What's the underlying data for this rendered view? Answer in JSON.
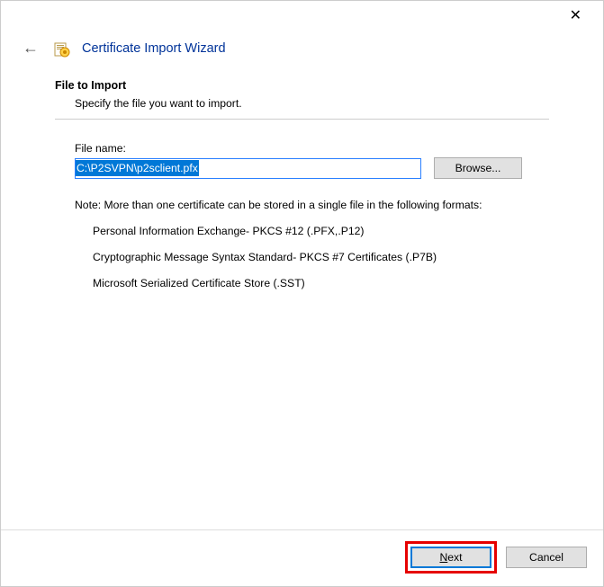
{
  "titlebar": {
    "close_label": "✕"
  },
  "header": {
    "back_glyph": "←",
    "wizard_title": "Certificate Import Wizard"
  },
  "section": {
    "title": "File to Import",
    "desc": "Specify the file you want to import."
  },
  "file": {
    "label": "File name:",
    "value": "C:\\P2SVPN\\p2sclient.pfx",
    "browse_label": "Browse..."
  },
  "note": "Note:  More than one certificate can be stored in a single file in the following formats:",
  "formats": [
    "Personal Information Exchange- PKCS #12 (.PFX,.P12)",
    "Cryptographic Message Syntax Standard- PKCS #7 Certificates (.P7B)",
    "Microsoft Serialized Certificate Store (.SST)"
  ],
  "buttons": {
    "next": "Next",
    "cancel": "Cancel"
  }
}
